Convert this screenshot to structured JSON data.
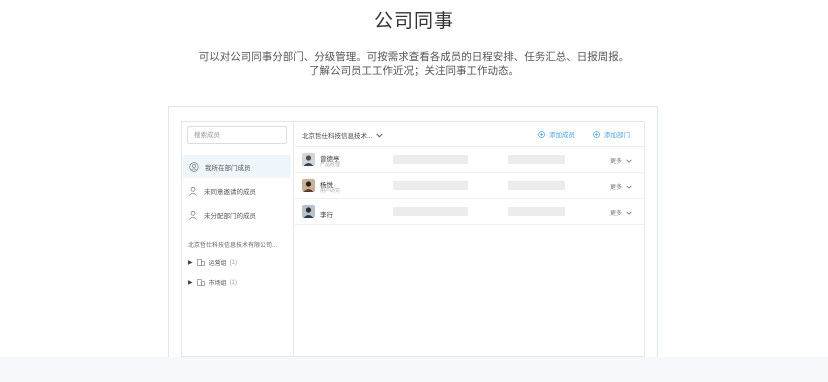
{
  "header": {
    "title": "公司同事",
    "description": "可以对公司同事分部门、分级管理。可按需求查看各成员的日程安排、任务汇总、日报周报。了解公司员工工作近况；关注同事工作动态。"
  },
  "sidebar": {
    "search_placeholder": "搜索成员",
    "items": [
      {
        "label": "我所在部门成员",
        "icon": "user-circle-icon",
        "active": true
      },
      {
        "label": "未同意邀请的成员",
        "icon": "user-icon",
        "active": false
      },
      {
        "label": "未分配部门的成员",
        "icon": "user-icon",
        "active": false
      }
    ],
    "company": "北京哲仕科技信息技术有限公司...",
    "departments": [
      {
        "name": "运营组",
        "count": "(1)"
      },
      {
        "name": "市场组",
        "count": "(1)"
      }
    ]
  },
  "toolbar": {
    "org_name": "北京哲仕科技信息技术...",
    "add_member": "添加成员",
    "add_department": "添加部门"
  },
  "members": [
    {
      "name": "曾德亭",
      "role": "产品经理",
      "more": "更多"
    },
    {
      "name": "杨悦",
      "role": "用户研究",
      "more": "更多"
    },
    {
      "name": "李行",
      "role": "",
      "more": "更多"
    }
  ],
  "colors": {
    "accent": "#4aa3df",
    "active_bg": "#eef5fb",
    "placeholder": "#ececec",
    "bottom_band": "#f5f9fc"
  }
}
